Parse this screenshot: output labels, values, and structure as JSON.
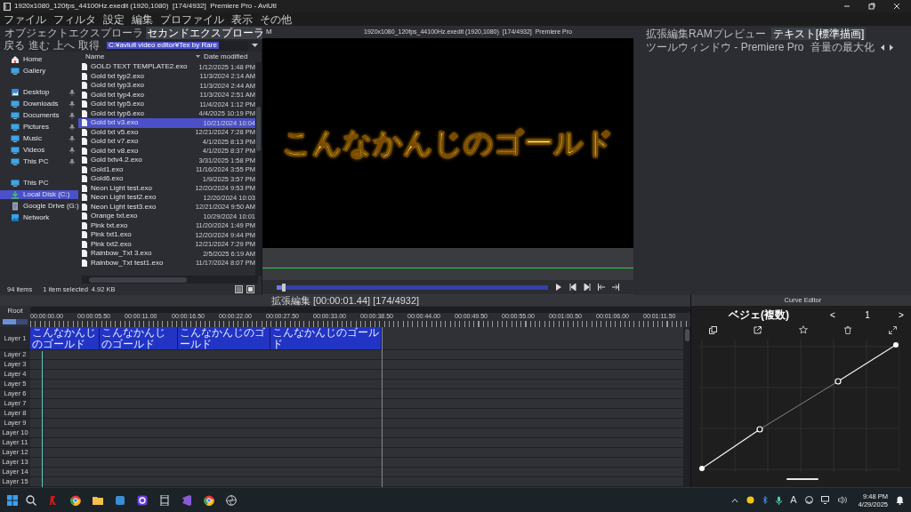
{
  "window": {
    "title": "1920x1080_120fps_44100Hz.exedit (1920,1080)  [174/4932]  Premiere Pro - AviUtl"
  },
  "menu": [
    "ファイル",
    "フィルタ",
    "設定",
    "編集",
    "プロファイル",
    "表示",
    "その他"
  ],
  "explorer": {
    "tabs": [
      {
        "label": "オブジェクトエクスプローラ",
        "selected": false
      },
      {
        "label": "セカンドエクスプローラ",
        "selected": true
      }
    ],
    "toolbar": [
      "戻る",
      "進む",
      "上へ",
      "取得"
    ],
    "path": "C:¥aviutl video editor¥Tex by Rare",
    "nav_groups": [
      [
        {
          "label": "Home",
          "pinned": false,
          "selected": false
        },
        {
          "label": "Gallery",
          "pinned": false,
          "selected": false
        }
      ],
      [
        {
          "label": "Desktop",
          "pinned": true,
          "selected": false
        },
        {
          "label": "Downloads",
          "pinned": true,
          "selected": false
        },
        {
          "label": "Documents",
          "pinned": true,
          "selected": false
        },
        {
          "label": "Pictures",
          "pinned": true,
          "selected": false
        },
        {
          "label": "Music",
          "pinned": true,
          "selected": false
        },
        {
          "label": "Videos",
          "pinned": true,
          "selected": false
        },
        {
          "label": "This PC",
          "pinned": true,
          "selected": false
        }
      ],
      [
        {
          "label": "This PC",
          "pinned": false,
          "selected": false
        },
        {
          "label": "Local Disk (C:)",
          "pinned": false,
          "selected": true
        },
        {
          "label": "Google Drive (G:)",
          "pinned": false,
          "selected": false
        },
        {
          "label": "Network",
          "pinned": false,
          "selected": false
        }
      ]
    ],
    "columns": [
      "Name",
      "Date modified"
    ],
    "files": [
      {
        "name": "GOLD TEXT TEMPLATE2.exo",
        "date": "1/12/2025 1:48 PM",
        "selected": false
      },
      {
        "name": "Gold txt typ2.exo",
        "date": "11/3/2024 2:14 AM",
        "selected": false
      },
      {
        "name": "Gold txt typ3.exo",
        "date": "11/3/2024 2:44 AM",
        "selected": false
      },
      {
        "name": "Gold txt typ4.exo",
        "date": "11/3/2024 2:51 AM",
        "selected": false
      },
      {
        "name": "Gold txt typ5.exo",
        "date": "11/4/2024 1:12 PM",
        "selected": false
      },
      {
        "name": "Gold txt typ6.exo",
        "date": "4/4/2025 10:19 PM",
        "selected": false
      },
      {
        "name": "Gold txt v3.exo",
        "date": "10/21/2024 10:04",
        "selected": true
      },
      {
        "name": "Gold txt v5.exo",
        "date": "12/21/2024 7:28 PM",
        "selected": false
      },
      {
        "name": "Gold txt v7.exo",
        "date": "4/1/2025 8:13 PM",
        "selected": false
      },
      {
        "name": "Gold txt v8.exo",
        "date": "4/1/2025 8:37 PM",
        "selected": false
      },
      {
        "name": "Gold txtv4.2.exo",
        "date": "3/31/2025 1:58 PM",
        "selected": false
      },
      {
        "name": "Gold1.exo",
        "date": "11/16/2024 3:55 PM",
        "selected": false
      },
      {
        "name": "Gold6.exo",
        "date": "1/9/2025 3:57 PM",
        "selected": false
      },
      {
        "name": "Neon Light test.exo",
        "date": "12/20/2024 9:53 PM",
        "selected": false
      },
      {
        "name": "Neon Light test2.exo",
        "date": "12/20/2024 10:03",
        "selected": false
      },
      {
        "name": "Neon Light test3.exo",
        "date": "12/21/2024 9:50 AM",
        "selected": false
      },
      {
        "name": "Orange txt.exo",
        "date": "10/29/2024 10:01",
        "selected": false
      },
      {
        "name": "Pink txt.exo",
        "date": "11/20/2024 1:49 PM",
        "selected": false
      },
      {
        "name": "Pink txt1.exo",
        "date": "12/20/2024 9:44 PM",
        "selected": false
      },
      {
        "name": "Pink txt2.exo",
        "date": "12/21/2024 7:29 PM",
        "selected": false
      },
      {
        "name": "Rainbow_Txt 3.exo",
        "date": "2/5/2025 6:19 AM",
        "selected": false
      },
      {
        "name": "Rainbow_Txt test1.exo",
        "date": "11/17/2024 8:07 PM",
        "selected": false
      }
    ],
    "status": {
      "count": "94 items",
      "selection": "1 item selected",
      "size": "4.92 KB"
    }
  },
  "preview": {
    "label": "M",
    "title": "1920x1080_120fps_44100Hz.exedit (1920,1080)  [174/4932]  Premiere Pro",
    "caption": "こんなかんじのゴールド",
    "seek": {
      "level": 0.02
    }
  },
  "panel_tabs": [
    {
      "label": "拡張編集RAMプレビュー",
      "selected": false
    },
    {
      "label": "テキスト[標準描画]",
      "selected": true
    },
    {
      "label": "ツールウィンドウ - Premiere Pro",
      "selected": false
    },
    {
      "label": "音量の最大化",
      "selected": false
    }
  ],
  "timeline": {
    "title": "拡張編集 [00:00:01.44] [174/4932]",
    "root": "Root",
    "layer_zoom": {
      "level": 0.55
    },
    "ticks": [
      "00:00:00.00",
      "00:00:05.50",
      "00:00:11.00",
      "00:00:16.50",
      "00:00:22.00",
      "00:00:27.50",
      "00:00:33.00",
      "00:00:38.50",
      "00:00:44.00",
      "00:00:49.50",
      "00:00:55.00",
      "00:01:00.50",
      "00:01:06.00",
      "00:01:11.50"
    ],
    "layers": [
      "Layer 1",
      "Layer 2",
      "Layer 3",
      "Layer 4",
      "Layer 5",
      "Layer 6",
      "Layer 7",
      "Layer 8",
      "Layer 9",
      "Layer 10",
      "Layer 11",
      "Layer 12",
      "Layer 13",
      "Layer 14",
      "Layer 15"
    ],
    "clips": [
      "こんなかんじのゴールド",
      "こんなかんじのゴールド",
      "こんなかんじのゴールド",
      "こんなかんじのゴールド"
    ]
  },
  "curve_editor": {
    "title": "Curve Editor",
    "mode": "ベジェ(複数)",
    "prev": "<",
    "index": "1",
    "next": ">"
  },
  "taskbar": {
    "ime": "A",
    "time": "9:48 PM",
    "date": "4/29/2025"
  }
}
